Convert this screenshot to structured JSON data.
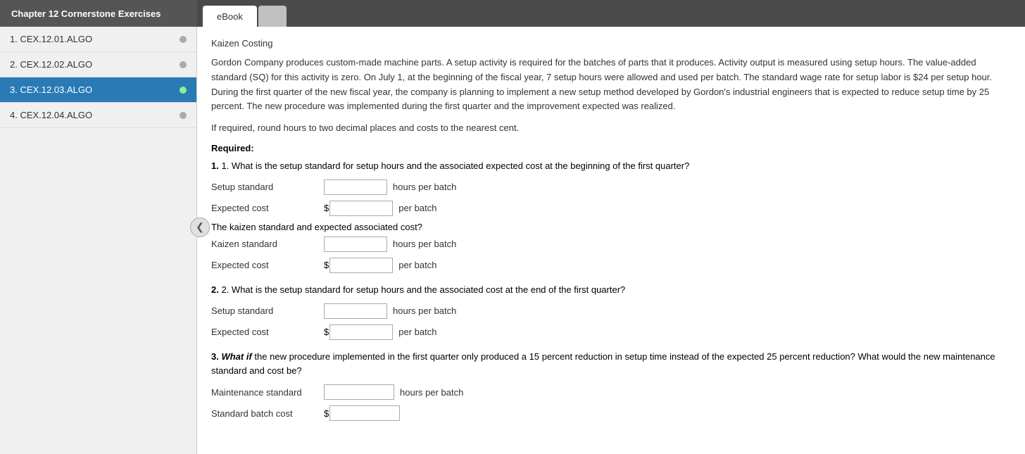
{
  "header": {
    "chapter_title": "Chapter 12 Cornerstone Exercises",
    "tabs": [
      {
        "label": "eBook",
        "active": true
      },
      {
        "label": "",
        "active": false
      }
    ]
  },
  "sidebar": {
    "items": [
      {
        "id": "cex1201",
        "label": "1. CEX.12.01.ALGO",
        "active": false
      },
      {
        "id": "cex1202",
        "label": "2. CEX.12.02.ALGO",
        "active": false
      },
      {
        "id": "cex1203",
        "label": "3. CEX.12.03.ALGO",
        "active": true
      },
      {
        "id": "cex1204",
        "label": "4. CEX.12.04.ALGO",
        "active": false
      }
    ]
  },
  "content": {
    "section_title": "Kaizen Costing",
    "problem_text": "Gordon Company produces custom-made machine parts. A setup activity is required for the batches of parts that it produces. Activity output is measured using setup hours. The value-added standard (SQ) for this activity is zero. On July 1, at the beginning of the fiscal year, 7 setup hours were allowed and used per batch. The standard wage rate for setup labor is $24 per setup hour. During the first quarter of the new fiscal year, the company is planning to implement a new setup method developed by Gordon's industrial engineers that is expected to reduce setup time by 25 percent. The new procedure was implemented during the first quarter and the improvement expected was realized.",
    "instruction": "If required, round hours to two decimal places and costs to the nearest cent.",
    "required_label": "Required:",
    "question1": {
      "label": "1. What is the setup standard for setup hours and the associated expected cost at the beginning of the first quarter?",
      "setup_standard_label": "Setup standard",
      "setup_standard_unit": "hours per batch",
      "expected_cost_label": "Expected cost",
      "expected_cost_unit": "per batch",
      "kaizen_section_label": "The kaizen standard and expected associated cost?",
      "kaizen_standard_label": "Kaizen standard",
      "kaizen_standard_unit": "hours per batch",
      "kaizen_expected_cost_label": "Expected cost",
      "kaizen_expected_cost_unit": "per batch"
    },
    "question2": {
      "label": "2. What is the setup standard for setup hours and the associated cost at the end of the first quarter?",
      "setup_standard_label": "Setup standard",
      "setup_standard_unit": "hours per batch",
      "expected_cost_label": "Expected cost",
      "expected_cost_unit": "per batch"
    },
    "question3": {
      "label_prefix": "3.",
      "label_italic": "What if",
      "label_suffix": "the new procedure implemented in the first quarter only produced a 15 percent reduction in setup time instead of the expected 25 percent reduction? What would the new maintenance standard and cost be?",
      "maintenance_standard_label": "Maintenance standard",
      "maintenance_standard_unit": "hours per batch",
      "standard_batch_cost_label": "Standard batch cost",
      "dollar": "$"
    },
    "dollar": "$",
    "collapse_btn_label": "❮"
  }
}
